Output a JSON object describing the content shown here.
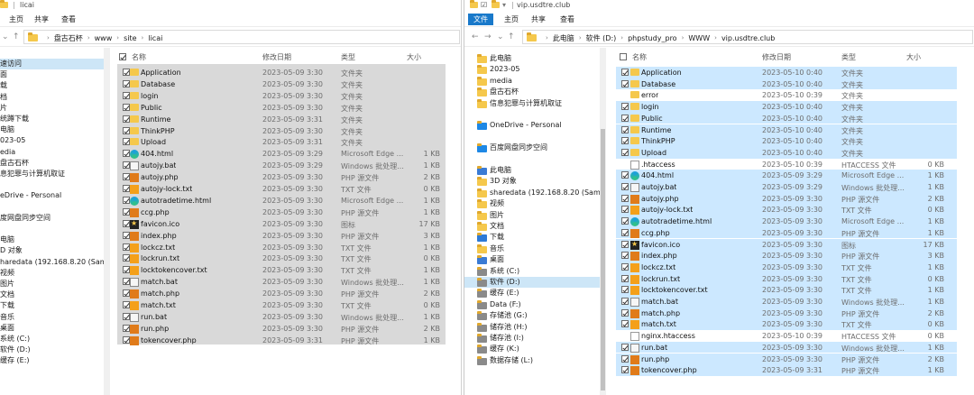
{
  "left": {
    "title": "licai",
    "ribbon": [
      "主页",
      "共享",
      "查看"
    ],
    "crumbs": [
      "盘古石杯",
      "www",
      "site",
      "licai"
    ],
    "nav": [
      {
        "label": "速访问",
        "sel": true
      },
      {
        "label": "面"
      },
      {
        "label": "载"
      },
      {
        "label": "档"
      },
      {
        "label": "片"
      },
      {
        "label": "统蹲下载"
      },
      {
        "label": "电脑"
      },
      {
        "label": "023-05"
      },
      {
        "label": "edia"
      },
      {
        "label": "盘古石杯"
      },
      {
        "label": "息犯罪与计算机取证"
      },
      {
        "label": ""
      },
      {
        "label": "eDrive - Personal"
      },
      {
        "label": ""
      },
      {
        "label": "度网盘同步空间"
      },
      {
        "label": ""
      },
      {
        "label": "电脑"
      },
      {
        "label": "D 对象"
      },
      {
        "label": "haredata (192.168.8.20 (Samba d"
      },
      {
        "label": "视频"
      },
      {
        "label": "图片"
      },
      {
        "label": "文档"
      },
      {
        "label": "下载"
      },
      {
        "label": "音乐"
      },
      {
        "label": "桌面"
      },
      {
        "label": "系统 (C:)"
      },
      {
        "label": "软件 (D:)"
      },
      {
        "label": "缓存 (E:)"
      }
    ],
    "columns": {
      "name": "名称",
      "date": "修改日期",
      "type": "类型",
      "size": "大小"
    },
    "files": [
      {
        "name": "Application",
        "date": "2023-05-09 3:30",
        "type": "文件夹",
        "size": "",
        "icon": "fold"
      },
      {
        "name": "Database",
        "date": "2023-05-09 3:30",
        "type": "文件夹",
        "size": "",
        "icon": "fold"
      },
      {
        "name": "login",
        "date": "2023-05-09 3:30",
        "type": "文件夹",
        "size": "",
        "icon": "fold"
      },
      {
        "name": "Public",
        "date": "2023-05-09 3:30",
        "type": "文件夹",
        "size": "",
        "icon": "fold"
      },
      {
        "name": "Runtime",
        "date": "2023-05-09 3:31",
        "type": "文件夹",
        "size": "",
        "icon": "fold"
      },
      {
        "name": "ThinkPHP",
        "date": "2023-05-09 3:30",
        "type": "文件夹",
        "size": "",
        "icon": "fold"
      },
      {
        "name": "Upload",
        "date": "2023-05-09 3:31",
        "type": "文件夹",
        "size": "",
        "icon": "fold"
      },
      {
        "name": "404.html",
        "date": "2023-05-09 3:29",
        "type": "Microsoft Edge ...",
        "size": "1 KB",
        "icon": "edge"
      },
      {
        "name": "autojy.bat",
        "date": "2023-05-09 3:29",
        "type": "Windows 批处理...",
        "size": "1 KB",
        "icon": "bat"
      },
      {
        "name": "autojy.php",
        "date": "2023-05-09 3:30",
        "type": "PHP 源文件",
        "size": "2 KB",
        "icon": "php"
      },
      {
        "name": "autojy-lock.txt",
        "date": "2023-05-09 3:30",
        "type": "TXT 文件",
        "size": "0 KB",
        "icon": "txt"
      },
      {
        "name": "autotradetime.html",
        "date": "2023-05-09 3:30",
        "type": "Microsoft Edge ...",
        "size": "1 KB",
        "icon": "edge"
      },
      {
        "name": "ccg.php",
        "date": "2023-05-09 3:30",
        "type": "PHP 源文件",
        "size": "1 KB",
        "icon": "php"
      },
      {
        "name": "favicon.ico",
        "date": "2023-05-09 3:30",
        "type": "图标",
        "size": "17 KB",
        "icon": "fav"
      },
      {
        "name": "index.php",
        "date": "2023-05-09 3:30",
        "type": "PHP 源文件",
        "size": "3 KB",
        "icon": "php"
      },
      {
        "name": "lockcz.txt",
        "date": "2023-05-09 3:30",
        "type": "TXT 文件",
        "size": "1 KB",
        "icon": "txt"
      },
      {
        "name": "lockrun.txt",
        "date": "2023-05-09 3:30",
        "type": "TXT 文件",
        "size": "0 KB",
        "icon": "txt"
      },
      {
        "name": "locktokencover.txt",
        "date": "2023-05-09 3:30",
        "type": "TXT 文件",
        "size": "1 KB",
        "icon": "txt"
      },
      {
        "name": "match.bat",
        "date": "2023-05-09 3:30",
        "type": "Windows 批处理...",
        "size": "1 KB",
        "icon": "bat"
      },
      {
        "name": "match.php",
        "date": "2023-05-09 3:30",
        "type": "PHP 源文件",
        "size": "2 KB",
        "icon": "php"
      },
      {
        "name": "match.txt",
        "date": "2023-05-09 3:30",
        "type": "TXT 文件",
        "size": "0 KB",
        "icon": "txt"
      },
      {
        "name": "run.bat",
        "date": "2023-05-09 3:30",
        "type": "Windows 批处理...",
        "size": "1 KB",
        "icon": "bat"
      },
      {
        "name": "run.php",
        "date": "2023-05-09 3:30",
        "type": "PHP 源文件",
        "size": "2 KB",
        "icon": "php"
      },
      {
        "name": "tokencover.php",
        "date": "2023-05-09 3:31",
        "type": "PHP 源文件",
        "size": "1 KB",
        "icon": "php"
      }
    ]
  },
  "right": {
    "title": "vip.usdtre.club",
    "ribbon": [
      "文件",
      "主页",
      "共享",
      "查看"
    ],
    "crumbs": [
      "此电脑",
      "软件 (D:)",
      "phpstudy_pro",
      "WWW",
      "vip.usdtre.club"
    ],
    "nav": [
      {
        "label": "此电脑",
        "icon": "fold"
      },
      {
        "label": "2023-05",
        "icon": "fold"
      },
      {
        "label": "media",
        "icon": "fold"
      },
      {
        "label": "盘古石杯",
        "icon": "fold"
      },
      {
        "label": "信息犯罪与计算机取证",
        "icon": "fold"
      },
      {
        "label": ""
      },
      {
        "label": "OneDrive - Personal",
        "icon": "cloud"
      },
      {
        "label": ""
      },
      {
        "label": "百度网盘同步空间",
        "icon": "cloud"
      },
      {
        "label": ""
      },
      {
        "label": "此电脑",
        "icon": "pc"
      },
      {
        "label": "3D 对象",
        "icon": "obj"
      },
      {
        "label": "sharedata (192.168.8.20 (Samba d",
        "icon": "net"
      },
      {
        "label": "视频",
        "icon": "vid"
      },
      {
        "label": "图片",
        "icon": "pic"
      },
      {
        "label": "文档",
        "icon": "doc"
      },
      {
        "label": "下载",
        "icon": "dl"
      },
      {
        "label": "音乐",
        "icon": "mus"
      },
      {
        "label": "桌面",
        "icon": "desk"
      },
      {
        "label": "系统 (C:)",
        "icon": "drive"
      },
      {
        "label": "软件 (D:)",
        "icon": "drive",
        "sel": true
      },
      {
        "label": "缓存 (E:)",
        "icon": "drive"
      },
      {
        "label": "Data (F:)",
        "icon": "drive"
      },
      {
        "label": "存储池 (G:)",
        "icon": "drive"
      },
      {
        "label": "储存池 (H:)",
        "icon": "drive"
      },
      {
        "label": "储存池 (I:)",
        "icon": "drive"
      },
      {
        "label": "缓存 (K:)",
        "icon": "drive"
      },
      {
        "label": "数据存储 (L:)",
        "icon": "drive"
      }
    ],
    "columns": {
      "name": "名称",
      "date": "修改日期",
      "type": "类型",
      "size": "大小"
    },
    "files": [
      {
        "name": "Application",
        "date": "2023-05-10 0:40",
        "type": "文件夹",
        "size": "",
        "icon": "fold",
        "sel": true
      },
      {
        "name": "Database",
        "date": "2023-05-10 0:40",
        "type": "文件夹",
        "size": "",
        "icon": "fold",
        "sel": true
      },
      {
        "name": "error",
        "date": "2023-05-10 0:39",
        "type": "文件夹",
        "size": "",
        "icon": "fold",
        "sel": false
      },
      {
        "name": "login",
        "date": "2023-05-10 0:40",
        "type": "文件夹",
        "size": "",
        "icon": "fold",
        "sel": true
      },
      {
        "name": "Public",
        "date": "2023-05-10 0:40",
        "type": "文件夹",
        "size": "",
        "icon": "fold",
        "sel": true
      },
      {
        "name": "Runtime",
        "date": "2023-05-10 0:40",
        "type": "文件夹",
        "size": "",
        "icon": "fold",
        "sel": true
      },
      {
        "name": "ThinkPHP",
        "date": "2023-05-10 0:40",
        "type": "文件夹",
        "size": "",
        "icon": "fold",
        "sel": true
      },
      {
        "name": "Upload",
        "date": "2023-05-10 0:40",
        "type": "文件夹",
        "size": "",
        "icon": "fold",
        "sel": true
      },
      {
        "name": ".htaccess",
        "date": "2023-05-10 0:39",
        "type": "HTACCESS 文件",
        "size": "0 KB",
        "icon": "file",
        "sel": false
      },
      {
        "name": "404.html",
        "date": "2023-05-09 3:29",
        "type": "Microsoft Edge ...",
        "size": "1 KB",
        "icon": "edge",
        "sel": true
      },
      {
        "name": "autojy.bat",
        "date": "2023-05-09 3:29",
        "type": "Windows 批处理...",
        "size": "1 KB",
        "icon": "bat",
        "sel": true
      },
      {
        "name": "autojy.php",
        "date": "2023-05-09 3:30",
        "type": "PHP 源文件",
        "size": "2 KB",
        "icon": "php",
        "sel": true
      },
      {
        "name": "autojy-lock.txt",
        "date": "2023-05-09 3:30",
        "type": "TXT 文件",
        "size": "0 KB",
        "icon": "txt",
        "sel": true
      },
      {
        "name": "autotradetime.html",
        "date": "2023-05-09 3:30",
        "type": "Microsoft Edge ...",
        "size": "1 KB",
        "icon": "edge",
        "sel": true
      },
      {
        "name": "ccg.php",
        "date": "2023-05-09 3:30",
        "type": "PHP 源文件",
        "size": "1 KB",
        "icon": "php",
        "sel": true
      },
      {
        "name": "favicon.ico",
        "date": "2023-05-09 3:30",
        "type": "图标",
        "size": "17 KB",
        "icon": "fav",
        "sel": true
      },
      {
        "name": "index.php",
        "date": "2023-05-09 3:30",
        "type": "PHP 源文件",
        "size": "3 KB",
        "icon": "php",
        "sel": true
      },
      {
        "name": "lockcz.txt",
        "date": "2023-05-09 3:30",
        "type": "TXT 文件",
        "size": "1 KB",
        "icon": "txt",
        "sel": true
      },
      {
        "name": "lockrun.txt",
        "date": "2023-05-09 3:30",
        "type": "TXT 文件",
        "size": "0 KB",
        "icon": "txt",
        "sel": true
      },
      {
        "name": "locktokencover.txt",
        "date": "2023-05-09 3:30",
        "type": "TXT 文件",
        "size": "1 KB",
        "icon": "txt",
        "sel": true
      },
      {
        "name": "match.bat",
        "date": "2023-05-09 3:30",
        "type": "Windows 批处理...",
        "size": "1 KB",
        "icon": "bat",
        "sel": true
      },
      {
        "name": "match.php",
        "date": "2023-05-09 3:30",
        "type": "PHP 源文件",
        "size": "2 KB",
        "icon": "php",
        "sel": true
      },
      {
        "name": "match.txt",
        "date": "2023-05-09 3:30",
        "type": "TXT 文件",
        "size": "0 KB",
        "icon": "txt",
        "sel": true
      },
      {
        "name": "nginx.htaccess",
        "date": "2023-05-10 0:39",
        "type": "HTACCESS 文件",
        "size": "0 KB",
        "icon": "file",
        "sel": false
      },
      {
        "name": "run.bat",
        "date": "2023-05-09 3:30",
        "type": "Windows 批处理...",
        "size": "1 KB",
        "icon": "bat",
        "sel": true
      },
      {
        "name": "run.php",
        "date": "2023-05-09 3:30",
        "type": "PHP 源文件",
        "size": "2 KB",
        "icon": "php",
        "sel": true
      },
      {
        "name": "tokencover.php",
        "date": "2023-05-09 3:31",
        "type": "PHP 源文件",
        "size": "1 KB",
        "icon": "php",
        "sel": true
      }
    ]
  }
}
